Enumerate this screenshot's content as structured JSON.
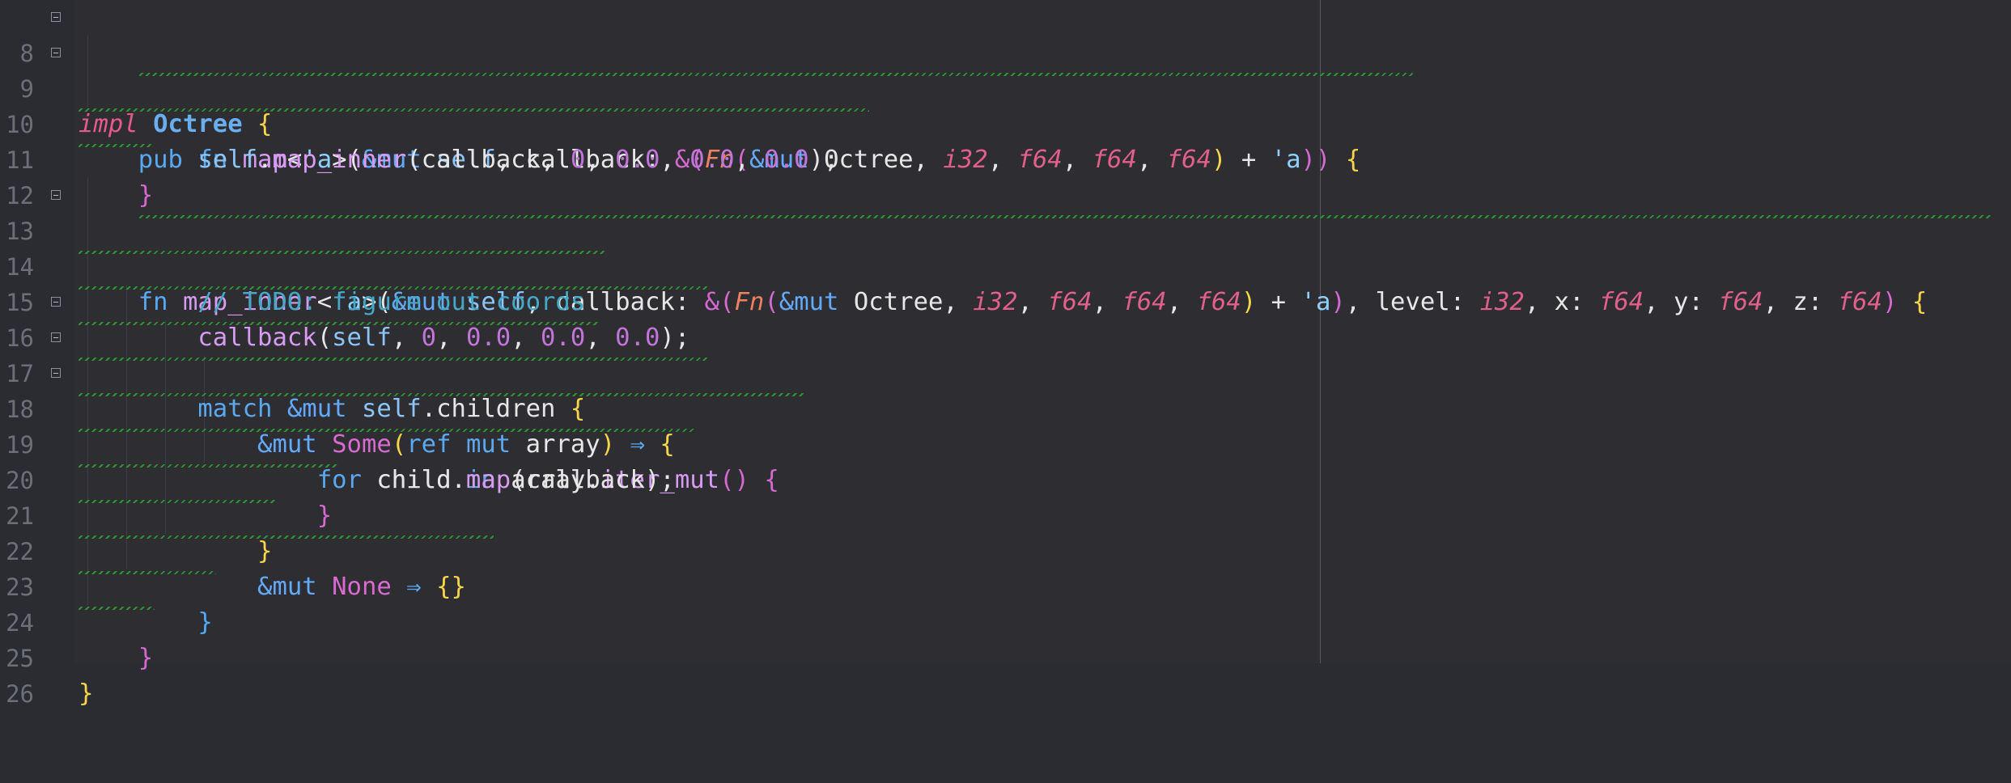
{
  "editor": {
    "lines": [
      {
        "num": "8",
        "text": "impl Octree {"
      },
      {
        "num": "9",
        "text": "    pub fn map<'a>(&mut self, callback: &(Fn(&mut Octree, i32, f64, f64, f64) + 'a)) {"
      },
      {
        "num": "10",
        "text": "        self.map_inner(callback, 0, 0.0, 0.0, 0.0);"
      },
      {
        "num": "11",
        "text": "    }"
      },
      {
        "num": "12",
        "text": ""
      },
      {
        "num": "13",
        "text": "    fn map_inner<'a>(&mut self, callback: &(Fn(&mut Octree, i32, f64, f64, f64) + 'a), level: i32, x: f64, y: f64, z: f64) {"
      },
      {
        "num": "14",
        "text": "        // TODO: figure out coords"
      },
      {
        "num": "15",
        "text": "        callback(self, 0, 0.0, 0.0, 0.0);"
      },
      {
        "num": "16",
        "text": "        match &mut self.children {"
      },
      {
        "num": "17",
        "text": "            &mut Some(ref mut array) ⇒ {"
      },
      {
        "num": "18",
        "text": "                for child in array.iter_mut() {"
      },
      {
        "num": "19",
        "text": "                    child.map(callback);"
      },
      {
        "num": "20",
        "text": "                }"
      },
      {
        "num": "21",
        "text": "            }"
      },
      {
        "num": "22",
        "text": "            &mut None ⇒ {}"
      },
      {
        "num": "23",
        "text": "        }"
      },
      {
        "num": "24",
        "text": "    }"
      },
      {
        "num": "25",
        "text": "}"
      },
      {
        "num": "26",
        "text": ""
      }
    ]
  },
  "colors": {
    "background": "#2b2c31",
    "line_number": "#6c6f7a",
    "keyword": "#5aa9f0",
    "type": "#6aaef0",
    "number": "#c275d9",
    "primitive": "#e0608a",
    "comment": "#45a8c5",
    "brace": "#f6d54b",
    "warning_squiggle": "#2f9a34"
  }
}
